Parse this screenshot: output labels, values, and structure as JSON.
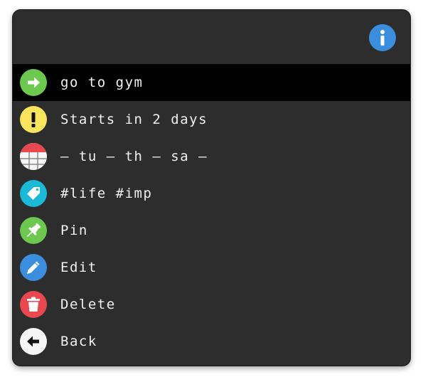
{
  "colors": {
    "window_bg": "#2d2d2d",
    "selected_bg": "#000000",
    "text": "#f2f2f2",
    "info": "#3b8ede",
    "green": "#6cc84f",
    "yellow": "#f9e45b",
    "cyan": "#1ab9d8",
    "blue": "#3b8ede",
    "red": "#e8484e",
    "white": "#f5f5f5"
  },
  "header": {
    "info_icon": "info-icon"
  },
  "menu": {
    "items": [
      {
        "label": "go to gym",
        "icon": "arrow-right-icon",
        "selected": true
      },
      {
        "label": "Starts in 2 days",
        "icon": "exclamation-icon"
      },
      {
        "label": "— tu — th — sa —",
        "icon": "calendar-icon"
      },
      {
        "label": "#life #imp",
        "icon": "tag-icon"
      },
      {
        "label": "Pin",
        "icon": "pin-icon"
      },
      {
        "label": "Edit",
        "icon": "pencil-icon"
      },
      {
        "label": "Delete",
        "icon": "trash-icon"
      },
      {
        "label": "Back",
        "icon": "arrow-left-icon"
      }
    ]
  }
}
